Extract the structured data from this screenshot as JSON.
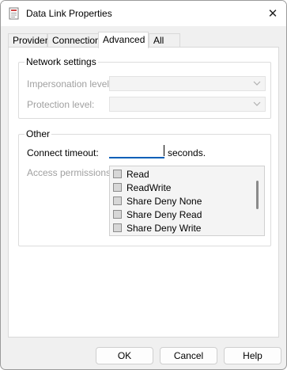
{
  "window": {
    "title": "Data Link Properties",
    "close_glyph": "✕"
  },
  "tabs": [
    {
      "label": "Provider",
      "active": false
    },
    {
      "label": "Connection",
      "active": false
    },
    {
      "label": "Advanced",
      "active": true
    },
    {
      "label": "All",
      "active": false
    }
  ],
  "network_settings": {
    "title": "Network settings",
    "impersonation_label": "Impersonation level:",
    "impersonation_value": "",
    "protection_label": "Protection level:",
    "protection_value": ""
  },
  "other": {
    "title": "Other",
    "connect_timeout_label": "Connect timeout:",
    "connect_timeout_value": "",
    "seconds_label": "seconds.",
    "access_permissions_label": "Access permissions:",
    "permissions": [
      "Read",
      "ReadWrite",
      "Share Deny None",
      "Share Deny Read",
      "Share Deny Write"
    ]
  },
  "buttons": {
    "ok": "OK",
    "cancel": "Cancel",
    "help": "Help"
  },
  "icons": {
    "app": "data-link-icon",
    "close": "close-icon",
    "chevron": "chevron-down-icon"
  }
}
